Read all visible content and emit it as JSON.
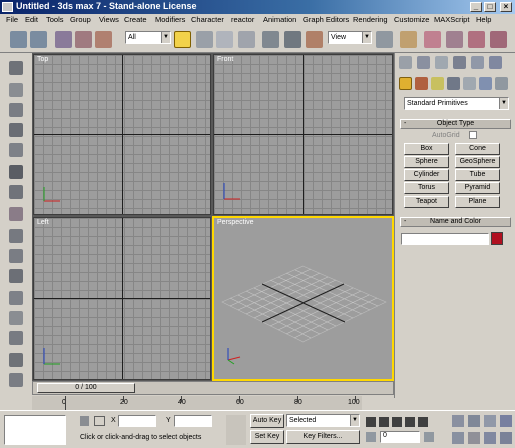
{
  "window": {
    "title": "Untitled - 3ds max 7 - Stand-alone License",
    "minimize": "_",
    "maximize": "□",
    "close": "×"
  },
  "menu": [
    "File",
    "Edit",
    "Tools",
    "Group",
    "Views",
    "Create",
    "Modifiers",
    "Character",
    "reactor",
    "Animation",
    "Graph Editors",
    "Rendering",
    "Customize",
    "MAXScript",
    "Help"
  ],
  "toolbar": {
    "selection_filter": "All",
    "reference_coord": "View"
  },
  "viewports": {
    "top": "Top",
    "front": "Front",
    "left": "Left",
    "perspective": "Perspective"
  },
  "command_panel": {
    "category_dropdown": "Standard Primitives",
    "object_type_header": "Object Type",
    "autogrid": "AutoGrid",
    "primitives": [
      "Box",
      "Cone",
      "Sphere",
      "GeoSphere",
      "Cylinder",
      "Tube",
      "Torus",
      "Pyramid",
      "Teapot",
      "Plane"
    ],
    "name_color_header": "Name and Color",
    "name_value": "",
    "swatch_color": "#b01020"
  },
  "timeline": {
    "slider_label": "0 / 100",
    "ticks": [
      "0",
      "20",
      "40",
      "60",
      "80",
      "100"
    ]
  },
  "status": {
    "prompt": "Click or click-and-drag to select objects",
    "x_label": "X",
    "y_label": "Y",
    "x_value": "",
    "y_value": "",
    "autokey": "Auto Key",
    "setkey": "Set Key",
    "selected": "Selected",
    "key_filters": "Key Filters...",
    "frame": "0"
  },
  "colors": {
    "active_viewport_border": "#ffd800",
    "viewport_bg": "#9d9d9d"
  }
}
